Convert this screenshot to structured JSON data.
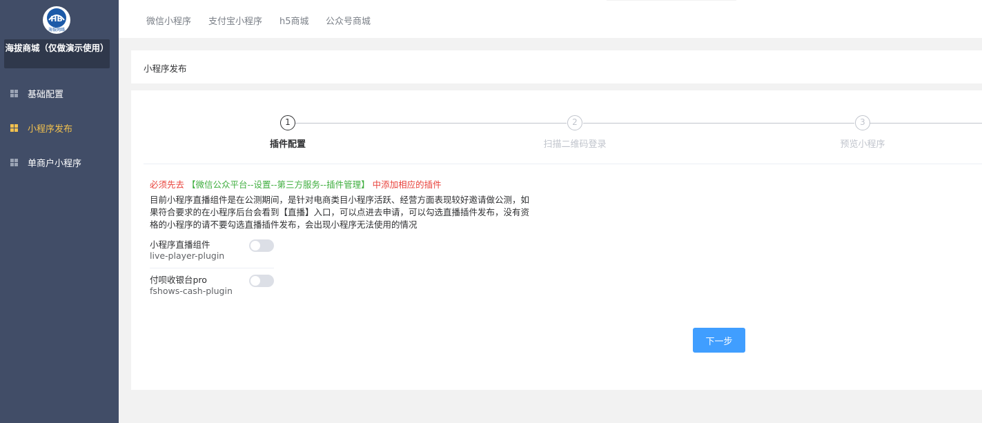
{
  "sidebar": {
    "shop_name": "海拔商城（仅做演示使用）",
    "logo_text": "海拔网络",
    "items": [
      {
        "label": "基础配置",
        "icon": "grid-icon",
        "active": false
      },
      {
        "label": "小程序发布",
        "icon": "grid-icon",
        "active": true
      },
      {
        "label": "单商户小程序",
        "icon": "grid-icon",
        "active": false
      }
    ],
    "active_color": "#f2c14e"
  },
  "topbar": {
    "tabs": [
      "微信小程序",
      "支付宝小程序",
      "h5商城",
      "公众号商城"
    ]
  },
  "breadcrumb": "小程序发布",
  "steps": [
    {
      "index": "1",
      "label": "插件配置",
      "done": true
    },
    {
      "index": "2",
      "label": "扫描二维码登录",
      "done": false
    },
    {
      "index": "3",
      "label": "预览小程序",
      "done": false
    }
  ],
  "notice": {
    "prefix": "必须先去",
    "path": "【微信公众平台--设置--第三方服务--插件管理】",
    "suffix": "中添加相应的插件"
  },
  "description": "目前小程序直播组件是在公测期间，是针对电商类目小程序活跃、经营方面表现较好邀请做公测，如果符合要求的在小程序后台会看到【直播】入口，可以点进去申请，可以勾选直播插件发布，没有资格的小程序的请不要勾选直播插件发布，会出现小程序无法使用的情况",
  "plugins": [
    {
      "name": "小程序直播组件",
      "key": "live-player-plugin",
      "enabled": false
    },
    {
      "name": "付呗收银台pro",
      "key": "fshows-cash-plugin",
      "enabled": false
    }
  ],
  "next_button": "下一步",
  "colors": {
    "primary": "#409eff",
    "sidebar_bg": "#414d67",
    "warn": "#e8413a",
    "link_green": "#3fae3f"
  }
}
